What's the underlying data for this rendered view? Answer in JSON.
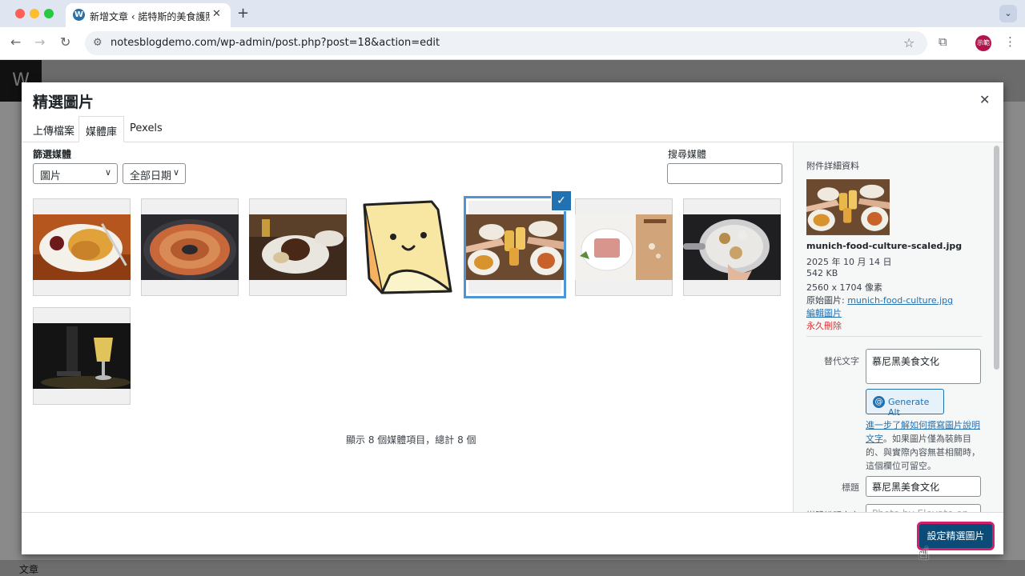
{
  "browser": {
    "tab_title": "新增文章 ‹ 諾特斯的美食護照 —",
    "url": "notesblogdemo.com/wp-admin/post.php?post=18&action=edit",
    "avatar_label": "示範"
  },
  "wp": {
    "bottom_label": "文章"
  },
  "modal": {
    "title": "精選圖片",
    "tabs": [
      "上傳檔案",
      "媒體庫",
      "Pexels"
    ],
    "filter_label": "篩選媒體",
    "type_filter": "圖片",
    "date_filter": "全部日期",
    "search_label": "搜尋媒體",
    "search_value": "",
    "count_text": "顯示 8 個媒體項目，總計 8 個",
    "primary_button": "設定精選圖片"
  },
  "sidebar": {
    "heading": "附件詳細資料",
    "filename": "munich-food-culture-scaled.jpg",
    "date": "2025 年 10 月 14 日",
    "size": "542 KB",
    "dimensions": "2560 x 1704 像素",
    "original_label": "原始圖片:",
    "original_link": "munich-food-culture.jpg",
    "edit_link": "編輯圖片",
    "delete_link": "永久刪除",
    "alt_label": "替代文字",
    "alt_value": "慕尼黑美食文化",
    "generate_alt": "Generate Alt",
    "help_link": "進一步了解如何撰寫圖片說明文字",
    "help_text": "。如果圖片僅為裝飾目的、與實際內容無甚相關時，這個欄位可留空。",
    "title_label": "標題",
    "title_value": "慕尼黑美食文化",
    "caption_label": "媒體說明文字",
    "caption_value": "Photo by Elevate on"
  },
  "colors": {
    "wp_blue": "#2271b1",
    "primary": "#0a4b78",
    "highlight": "#d31e6b",
    "danger": "#d63638"
  }
}
